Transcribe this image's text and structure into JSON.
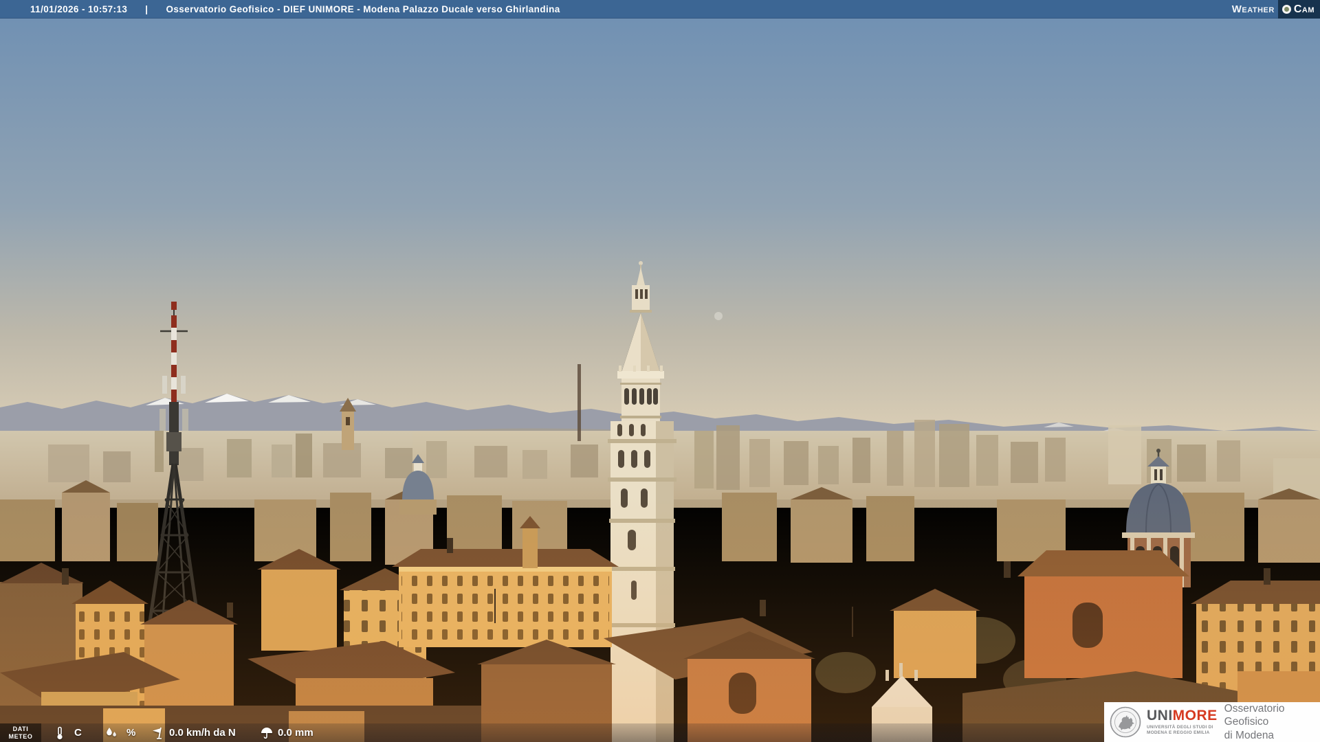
{
  "top_bar": {
    "timestamp": "11/01/2026 - 10:57:13",
    "separator": "|",
    "title": "Osservatorio Geofisico - DIEF UNIMORE - Modena Palazzo Ducale verso Ghirlandina",
    "brand": {
      "weather": "Weather",
      "cam": "Cam"
    }
  },
  "weather_bar": {
    "label_line1": "DATI",
    "label_line2": "METEO",
    "temperature_value": "",
    "temperature_unit": "C",
    "humidity_value": "",
    "humidity_unit": "%",
    "wind_value": "0.0 km/h da N",
    "rain_value": "0.0 mm"
  },
  "logo_box": {
    "uni": "UNI",
    "more": "MORE",
    "university_line1": "UNIVERSITÀ DEGLI STUDI DI",
    "university_line2": "MODENA E REGGIO EMILIA",
    "observatory_line1": "Osservatorio Geofisico",
    "observatory_line2": "di Modena"
  },
  "scene": {
    "description": "Panoramic webcam view of Modena from Palazzo Ducale toward the Ghirlandina tower, snowy Apennines on the horizon, golden morning light on terracotta rooftops",
    "landmarks": [
      "ghirlandina-tower",
      "telecom-lattice-tower",
      "church-dome",
      "small-blue-dome",
      "apennine-ridge",
      "crescent-moon"
    ]
  },
  "colors": {
    "top_bar_bg": "#3c6694",
    "cam_box_bg": "#17334e",
    "unimore_red": "#d63a21",
    "sky_top": "#7191b3",
    "sky_horizon": "#d9cdb6",
    "roof_brown": "#6e4a2c",
    "gold_wall": "#e2ae5c"
  }
}
